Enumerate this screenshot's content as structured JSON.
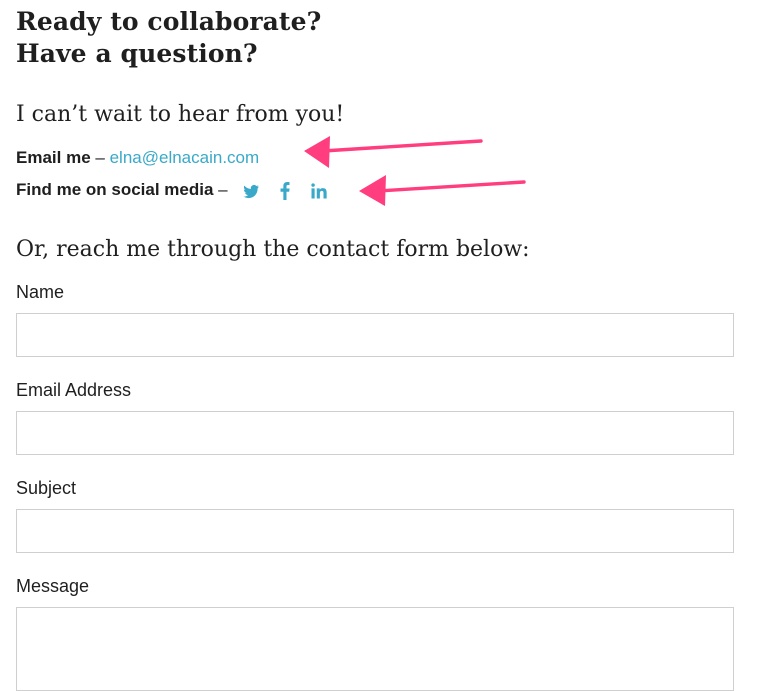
{
  "header": {
    "title_line1": "Ready to collaborate?",
    "title_line2": "Have a question?",
    "subtitle": "I can’t wait to hear from you!"
  },
  "contact": {
    "email_label": "Email me",
    "email_sep": "–",
    "email_value": "elna@elnacain.com",
    "social_label": "Find me on social media",
    "social_sep": "–",
    "social_icons": [
      "twitter-icon",
      "facebook-icon",
      "linkedin-icon"
    ]
  },
  "form": {
    "intro": "Or, reach me through the contact form below:",
    "name_label": "Name",
    "name_value": "",
    "email_label": "Email Address",
    "email_value": "",
    "subject_label": "Subject",
    "subject_value": "",
    "message_label": "Message",
    "message_value": ""
  },
  "colors": {
    "accent": "#3aa9c9",
    "annotation_arrow": "#ff3d7f",
    "text": "#1f1f1f",
    "field_border": "#cfcfcf"
  }
}
